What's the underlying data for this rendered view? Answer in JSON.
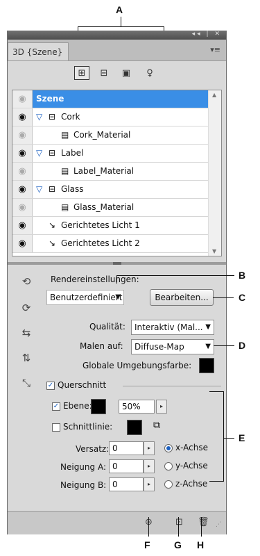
{
  "callouts": {
    "a": "A",
    "b": "B",
    "c": "C",
    "d": "D",
    "e": "E",
    "f": "F",
    "g": "G",
    "h": "H"
  },
  "window": {
    "collapse_glyph": "◂◂ | ✕",
    "tab_label": "3D {Szene}",
    "menu_glyph": "▾≡"
  },
  "filters": [
    {
      "name": "whole-scene-filter",
      "glyph": "⊞",
      "selected": true
    },
    {
      "name": "meshes-filter",
      "glyph": "⊟",
      "selected": false
    },
    {
      "name": "materials-filter",
      "glyph": "▣",
      "selected": false
    },
    {
      "name": "lights-filter",
      "glyph": "♀",
      "selected": false
    }
  ],
  "tree": {
    "rows": [
      {
        "label": "Szene",
        "type": "header",
        "eye": "dim"
      },
      {
        "label": "Cork",
        "type": "mesh",
        "eye": "on"
      },
      {
        "label": "Cork_Material",
        "type": "material",
        "eye": "dim"
      },
      {
        "label": "Label",
        "type": "mesh",
        "eye": "on"
      },
      {
        "label": "Label_Material",
        "type": "material",
        "eye": "dim"
      },
      {
        "label": "Glass",
        "type": "mesh",
        "eye": "on"
      },
      {
        "label": "Glass_Material",
        "type": "material",
        "eye": "dim"
      },
      {
        "label": "Gerichtetes Licht 1",
        "type": "light",
        "eye": "on"
      },
      {
        "label": "Gerichtetes Licht 2",
        "type": "light",
        "eye": "on"
      }
    ]
  },
  "render": {
    "section_label": "Rendereinstellungen:",
    "preset_value": "Benutzerdefiniert",
    "edit_button": "Bearbeiten...",
    "quality_label": "Qualität:",
    "quality_value": "Interaktiv (Mal...",
    "paint_label": "Malen auf:",
    "paint_value": "Diffuse-Map",
    "ambient_label": "Globale Umgebungsfarbe:"
  },
  "cross_section": {
    "label": "Querschnitt",
    "plane_label": "Ebene:",
    "plane_opacity": "50%",
    "intersection_label": "Schnittlinie:",
    "offset_label": "Versatz:",
    "offset_value": "0",
    "tilt_a_label": "Neigung A:",
    "tilt_a_value": "0",
    "tilt_b_label": "Neigung B:",
    "tilt_b_value": "0",
    "x_axis": "x-Achse",
    "y_axis": "y-Achse",
    "z_axis": "z-Achse"
  },
  "colors": {
    "selection": "#3a8ee6",
    "panel": "#d9d9d9"
  }
}
